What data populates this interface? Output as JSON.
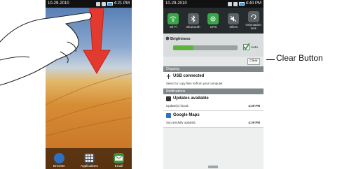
{
  "left_phone": {
    "status": {
      "date": "10-29-2010",
      "time": "4:21 PM"
    },
    "dock": [
      {
        "label": "Browser",
        "icon": "globe-icon",
        "color": "#2f6fc4"
      },
      {
        "label": "Applications",
        "icon": "grid-icon",
        "color": "#4a4f55"
      },
      {
        "label": "Email",
        "icon": "envelope-icon",
        "color": "#3e8f3a"
      }
    ]
  },
  "right_phone": {
    "status": {
      "date": "10-29-2010",
      "time": "4:40 PM"
    },
    "toggles": [
      {
        "label": "Wi-Fi",
        "icon": "wifi-icon",
        "color": "#3aa64a"
      },
      {
        "label": "Bluetooth",
        "icon": "bluetooth-icon",
        "color": "#5b6366"
      },
      {
        "label": "GPS",
        "icon": "gps-icon",
        "color": "#3aa64a"
      },
      {
        "label": "Silent",
        "icon": "silent-icon",
        "color": "#5b6366"
      },
      {
        "label": "Orientation lock",
        "icon": "rotation-lock-icon",
        "color": "#5b6366"
      }
    ],
    "brightness": {
      "title": "Brightness",
      "auto_label": "Auto",
      "level": 0.32
    },
    "clear_label": "Clear",
    "ongoing": {
      "header": "Ongoing",
      "title": "USB connected",
      "subtitle": "Select to copy files to/from your computer"
    },
    "notifications": {
      "header": "Notifications",
      "items": [
        {
          "title": "Updates available",
          "subtitle": "Update(s) found.",
          "time": "4:39 PM"
        },
        {
          "title": "Google Maps",
          "subtitle": "Successfully updated.",
          "time": "4:39 PM"
        }
      ]
    }
  },
  "annotation": {
    "label": "Clear Button"
  }
}
